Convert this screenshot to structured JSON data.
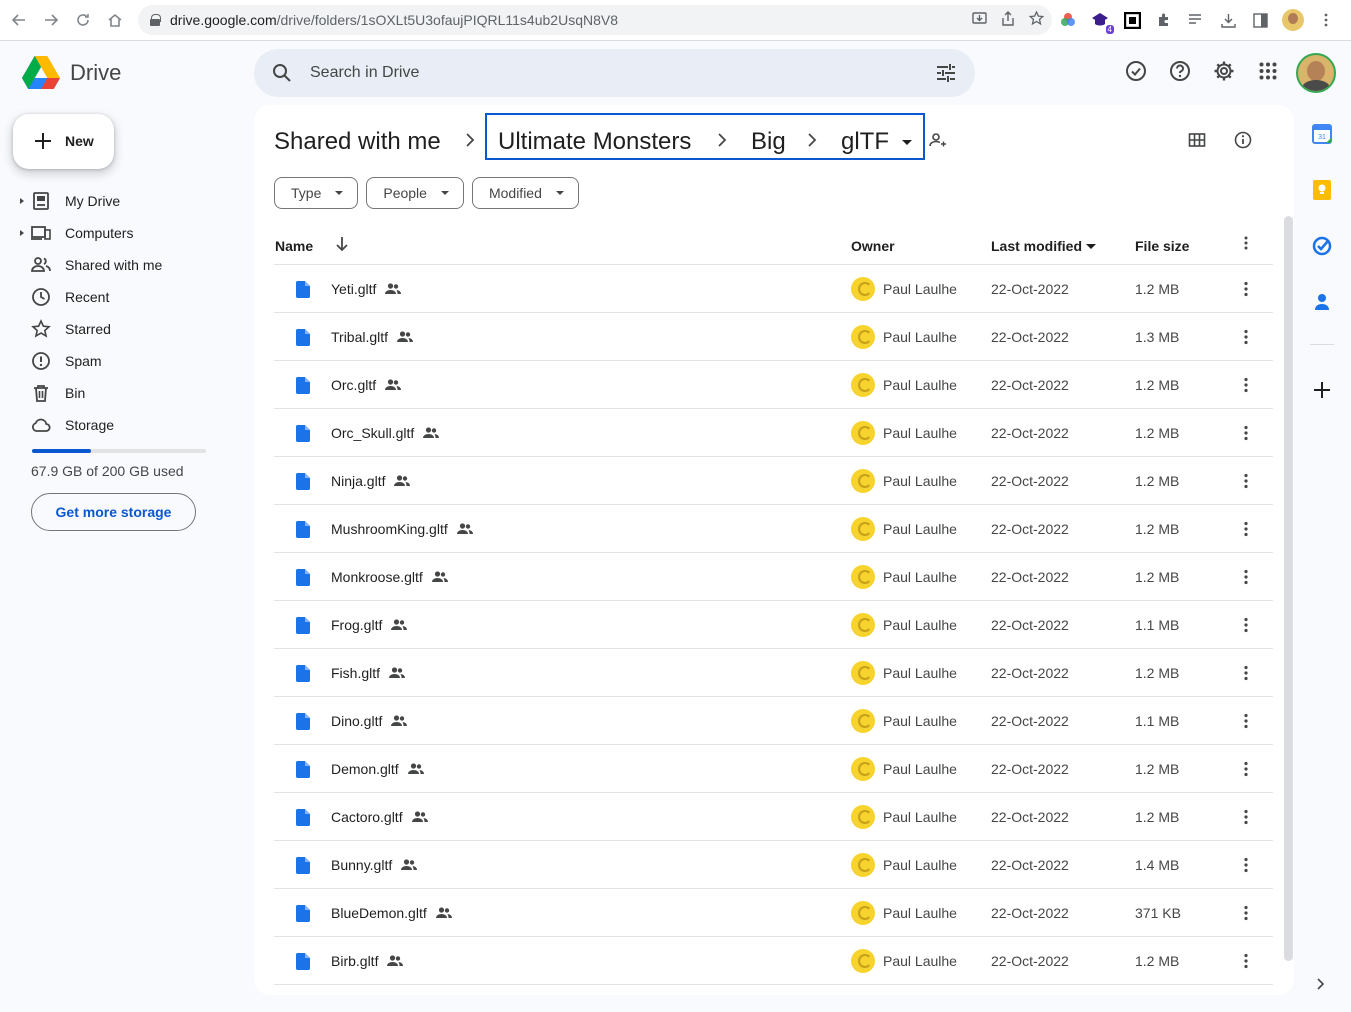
{
  "browser": {
    "url_domain": "drive.google.com",
    "url_path": "/drive/folders/1sOXLt5U3ofaujPIQRL11s4ub2UsqN8V8",
    "extension_badge": "4"
  },
  "app": {
    "name": "Drive",
    "search_placeholder": "Search in Drive"
  },
  "sidebar": {
    "new_label": "New",
    "items": [
      {
        "label": "My Drive",
        "icon": "my-drive-icon",
        "expandable": true
      },
      {
        "label": "Computers",
        "icon": "computers-icon",
        "expandable": true
      },
      {
        "label": "Shared with me",
        "icon": "shared-with-me-icon",
        "expandable": false
      },
      {
        "label": "Recent",
        "icon": "clock-icon",
        "expandable": false
      },
      {
        "label": "Starred",
        "icon": "star-icon",
        "expandable": false
      },
      {
        "label": "Spam",
        "icon": "spam-icon",
        "expandable": false
      },
      {
        "label": "Bin",
        "icon": "bin-icon",
        "expandable": false
      },
      {
        "label": "Storage",
        "icon": "cloud-icon",
        "expandable": false
      }
    ],
    "storage_used_fraction": 0.34,
    "storage_text": "67.9 GB of 200 GB used",
    "get_storage_label": "Get more storage"
  },
  "breadcrumb": {
    "root": "Shared with me",
    "items": [
      "Ultimate Monsters",
      "Big",
      "glTF"
    ]
  },
  "filters": [
    "Type",
    "People",
    "Modified"
  ],
  "table": {
    "columns": {
      "name": "Name",
      "owner": "Owner",
      "modified": "Last modified",
      "size": "File size"
    },
    "rows": [
      {
        "name": "Yeti.gltf",
        "owner": "Paul Laulhe",
        "modified": "22-Oct-2022",
        "size": "1.2 MB"
      },
      {
        "name": "Tribal.gltf",
        "owner": "Paul Laulhe",
        "modified": "22-Oct-2022",
        "size": "1.3 MB"
      },
      {
        "name": "Orc.gltf",
        "owner": "Paul Laulhe",
        "modified": "22-Oct-2022",
        "size": "1.2 MB"
      },
      {
        "name": "Orc_Skull.gltf",
        "owner": "Paul Laulhe",
        "modified": "22-Oct-2022",
        "size": "1.2 MB"
      },
      {
        "name": "Ninja.gltf",
        "owner": "Paul Laulhe",
        "modified": "22-Oct-2022",
        "size": "1.2 MB"
      },
      {
        "name": "MushroomKing.gltf",
        "owner": "Paul Laulhe",
        "modified": "22-Oct-2022",
        "size": "1.2 MB"
      },
      {
        "name": "Monkroose.gltf",
        "owner": "Paul Laulhe",
        "modified": "22-Oct-2022",
        "size": "1.2 MB"
      },
      {
        "name": "Frog.gltf",
        "owner": "Paul Laulhe",
        "modified": "22-Oct-2022",
        "size": "1.1 MB"
      },
      {
        "name": "Fish.gltf",
        "owner": "Paul Laulhe",
        "modified": "22-Oct-2022",
        "size": "1.2 MB"
      },
      {
        "name": "Dino.gltf",
        "owner": "Paul Laulhe",
        "modified": "22-Oct-2022",
        "size": "1.1 MB"
      },
      {
        "name": "Demon.gltf",
        "owner": "Paul Laulhe",
        "modified": "22-Oct-2022",
        "size": "1.2 MB"
      },
      {
        "name": "Cactoro.gltf",
        "owner": "Paul Laulhe",
        "modified": "22-Oct-2022",
        "size": "1.2 MB"
      },
      {
        "name": "Bunny.gltf",
        "owner": "Paul Laulhe",
        "modified": "22-Oct-2022",
        "size": "1.4 MB"
      },
      {
        "name": "BlueDemon.gltf",
        "owner": "Paul Laulhe",
        "modified": "22-Oct-2022",
        "size": "371 KB"
      },
      {
        "name": "Birb.gltf",
        "owner": "Paul Laulhe",
        "modified": "22-Oct-2022",
        "size": "1.2 MB"
      }
    ]
  },
  "colors": {
    "accent": "#0b57d0",
    "file_icon": "#1a73e8",
    "background": "#f8fafd",
    "search_bg": "#e9eef6"
  }
}
